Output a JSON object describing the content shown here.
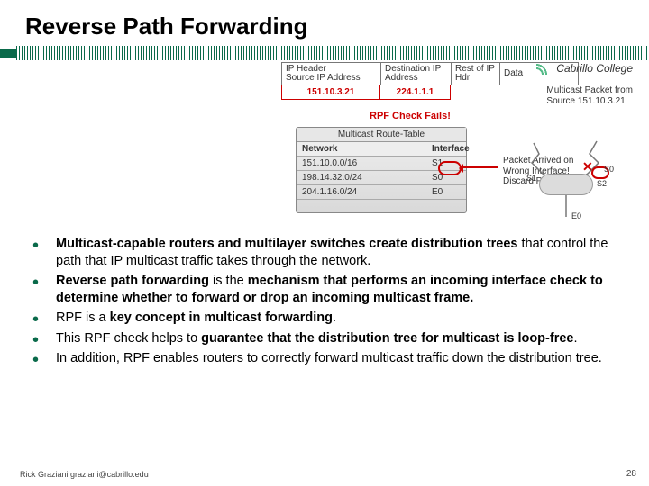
{
  "title": "Reverse Path Forwarding",
  "logo": "Cabrillo College",
  "packet_header": {
    "col1a": "IP Header",
    "col1b": "Source IP Address",
    "col2": "Destination IP Address",
    "col3": "Rest of IP Hdr",
    "col4": "Data",
    "src_val": "151.10.3.21",
    "dst_val": "224.1.1.1"
  },
  "mpkt_line1": "Multicast Packet from",
  "mpkt_line2": "Source 151.10.3.21",
  "rpf_fail": "RPF Check Fails!",
  "route_table": {
    "title": "Multicast Route-Table",
    "h1": "Network",
    "h2": "Interface",
    "rows": [
      {
        "net": "151.10.0.0/16",
        "if": "S1"
      },
      {
        "net": "198.14.32.0/24",
        "if": "S0"
      },
      {
        "net": "204.1.16.0/24",
        "if": "E0"
      }
    ]
  },
  "arrival_l1": "Packet Arrived on",
  "arrival_l2": "Wrong Interface!",
  "arrival_l3": "Discard Packet.",
  "if_labels": {
    "s0": "S0",
    "s1": "S1",
    "s2": "S2",
    "e0": "E0"
  },
  "bullets": [
    {
      "pre": "",
      "b1": "Multicast-capable routers and multilayer switches create distribution trees",
      "mid": " that control the path that IP multicast traffic takes through the network.",
      "b2": "",
      "post": ""
    },
    {
      "pre": "",
      "b1": "Reverse path forwarding",
      "mid": " is the ",
      "b2": "mechanism that performs an incoming interface check to determine whether to forward or drop an incoming multicast frame.",
      "post": ""
    },
    {
      "pre": "RPF is a ",
      "b1": "key concept in multicast forwarding",
      "mid": ".",
      "b2": "",
      "post": ""
    },
    {
      "pre": "This RPF check helps to ",
      "b1": "guarantee that the distribution tree for multicast is loop-free",
      "mid": ".",
      "b2": "",
      "post": ""
    },
    {
      "pre": "In addition, RPF enables routers to correctly forward multicast traffic down the distribution tree.",
      "b1": "",
      "mid": "",
      "b2": "",
      "post": ""
    }
  ],
  "footer": "Rick Graziani  graziani@cabrillo.edu",
  "page_number": "28"
}
